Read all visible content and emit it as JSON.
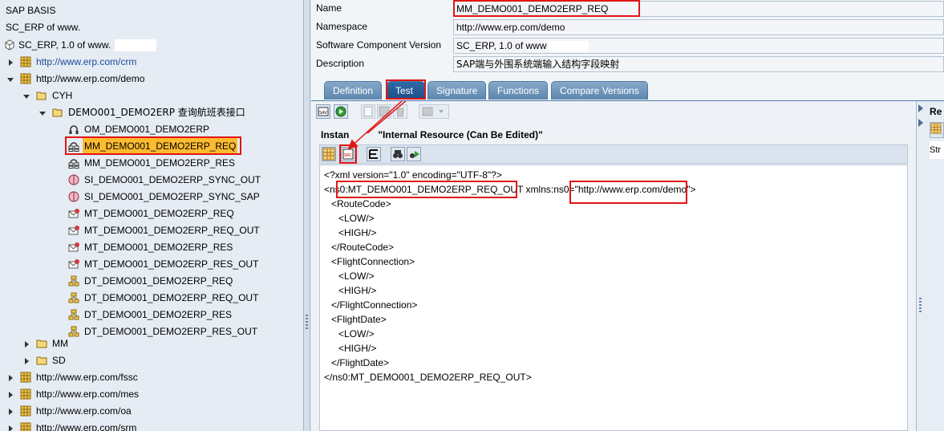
{
  "tree": {
    "root_items": [
      "SAP BASIS",
      "SC_ERP of www."
    ],
    "swcv_label": "SC_ERP, 1.0 of www.",
    "ns_crm": "http://www.erp.com/crm",
    "ns_demo": "http://www.erp.com/demo",
    "folder_cyh": "CYH",
    "folder_demo": "DEMO001_DEMO2ERP 查询航班表接口",
    "objects": [
      {
        "label": "OM_DEMO001_DEMO2ERP",
        "icon": "operation-mapping-icon"
      },
      {
        "label": "MM_DEMO001_DEMO2ERP_REQ",
        "icon": "message-mapping-icon",
        "selected": true
      },
      {
        "label": "MM_DEMO001_DEMO2ERP_RES",
        "icon": "message-mapping-icon"
      },
      {
        "label": "SI_DEMO001_DEMO2ERP_SYNC_OUT",
        "icon": "service-interface-icon"
      },
      {
        "label": "SI_DEMO001_DEMO2ERP_SYNC_SAP",
        "icon": "service-interface-icon"
      },
      {
        "label": "MT_DEMO001_DEMO2ERP_REQ",
        "icon": "message-type-icon"
      },
      {
        "label": "MT_DEMO001_DEMO2ERP_REQ_OUT",
        "icon": "message-type-icon"
      },
      {
        "label": "MT_DEMO001_DEMO2ERP_RES",
        "icon": "message-type-icon"
      },
      {
        "label": "MT_DEMO001_DEMO2ERP_RES_OUT",
        "icon": "message-type-icon"
      },
      {
        "label": "DT_DEMO001_DEMO2ERP_REQ",
        "icon": "data-type-icon"
      },
      {
        "label": "DT_DEMO001_DEMO2ERP_REQ_OUT",
        "icon": "data-type-icon"
      },
      {
        "label": "DT_DEMO001_DEMO2ERP_RES",
        "icon": "data-type-icon"
      },
      {
        "label": "DT_DEMO001_DEMO2ERP_RES_OUT",
        "icon": "data-type-icon"
      }
    ],
    "folder_mm": "MM",
    "folder_sd": "SD",
    "ns_fssc": "http://www.erp.com/fssc",
    "ns_mes": "http://www.erp.com/mes",
    "ns_oa": "http://www.erp.com/oa",
    "ns_srm": "http://www.erp.com/srm"
  },
  "header": {
    "name_label": "Name",
    "name_value": "MM_DEMO001_DEMO2ERP_REQ",
    "namespace_label": "Namespace",
    "namespace_value": "http://www.erp.com/demo",
    "swcv_label": "Software Component Version",
    "swcv_value": "SC_ERP, 1.0 of www",
    "description_label": "Description",
    "description_value": "SAP端与外围系统端输入结构字段映射"
  },
  "tabs": [
    "Definition",
    "Test",
    "Signature",
    "Functions",
    "Compare Versions"
  ],
  "active_tab": "Test",
  "instance_label": "Instance \"Internal Resource (Can Be Edited)\"",
  "instance_prefix": "Instan",
  "instance_suffix": "\"Internal Resource (Can Be Edited)\"",
  "xml": {
    "decl": "<?xml version=\"1.0\" encoding=\"UTF-8\"?>",
    "root_open_prefix": "<ns0",
    "root_open_name": ":MT_DEMO001_DEMO2ERP_REQ_OUT",
    "root_open_attr": " xmlns:ns0=",
    "root_open_value": "\"http://www.erp.com/demo\"",
    "root_open_end": ">",
    "lines": [
      {
        "indent": 1,
        "text": "<RouteCode>"
      },
      {
        "indent": 2,
        "text": "<LOW/>"
      },
      {
        "indent": 2,
        "text": "<HIGH/>"
      },
      {
        "indent": 1,
        "text": "</RouteCode>"
      },
      {
        "indent": 1,
        "text": "<FlightConnection>"
      },
      {
        "indent": 2,
        "text": "<LOW/>"
      },
      {
        "indent": 2,
        "text": "<HIGH/>"
      },
      {
        "indent": 1,
        "text": "</FlightConnection>"
      },
      {
        "indent": 1,
        "text": "<FlightDate>"
      },
      {
        "indent": 2,
        "text": "<LOW/>"
      },
      {
        "indent": 2,
        "text": "<HIGH/>"
      },
      {
        "indent": 1,
        "text": "</FlightDate>"
      },
      {
        "indent": 0,
        "text": "</ns0:MT_DEMO001_DEMO2ERP_REQ_OUT>"
      }
    ]
  },
  "right_panel": {
    "title": "Re",
    "text": "Str"
  },
  "colors": {
    "highlight": "#e01515",
    "selection": "#fdbb2f",
    "tab": "#6f95bb",
    "tab_active": "#2a5f98"
  }
}
